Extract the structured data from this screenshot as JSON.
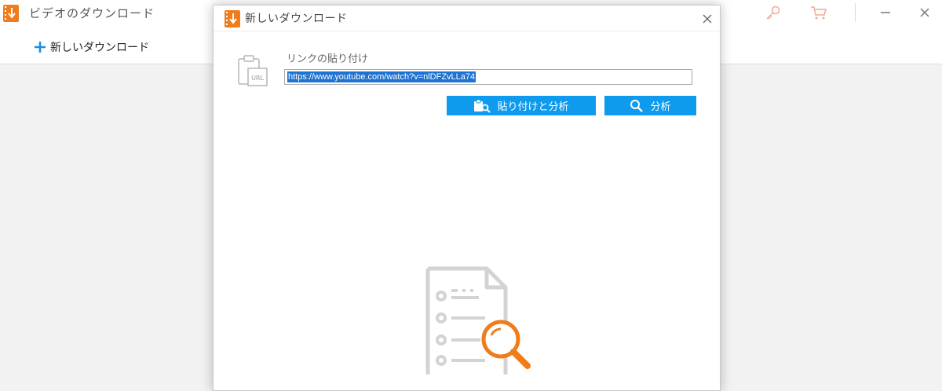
{
  "app": {
    "title": "ビデオのダウンロード",
    "accent_color": "#f07c1c",
    "titlebar_icons": [
      "key-icon",
      "cart-icon",
      "minimize-icon",
      "close-icon"
    ]
  },
  "toolbar": {
    "new_download_label": "新しいダウンロード"
  },
  "dialog": {
    "title": "新しいダウンロード",
    "paste_link_label": "リンクの貼り付け",
    "url_value": "https://www.youtube.com/watch?v=nlDFZvLLa74",
    "buttons": {
      "paste_analyze": "貼り付けと分析",
      "analyze": "分析"
    },
    "button_color": "#0e9bee"
  }
}
